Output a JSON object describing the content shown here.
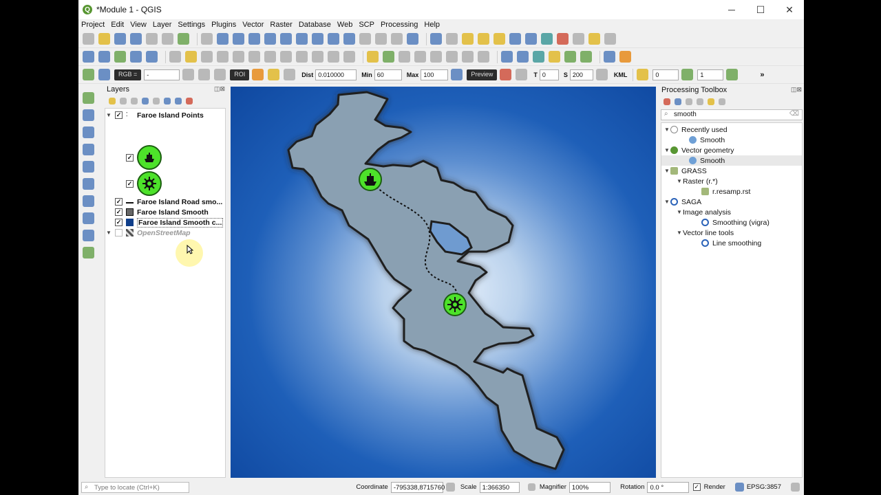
{
  "window": {
    "title": "*Module 1 - QGIS",
    "min": "─",
    "max": "☐",
    "close": "✕"
  },
  "menu": [
    "Project",
    "Edit",
    "View",
    "Layer",
    "Settings",
    "Plugins",
    "Vector",
    "Raster",
    "Database",
    "Web",
    "SCP",
    "Processing",
    "Help"
  ],
  "scp_toolbar": {
    "rgb_label": "RGB =",
    "rgb_value": "-",
    "roi_label": "ROI",
    "dist_label": "Dist",
    "dist_value": "0.010000",
    "min_label": "Min",
    "min_value": "60",
    "max_label": "Max",
    "max_value": "100",
    "preview_label": "Preview",
    "t_label": "T",
    "t_value": "0",
    "s_label": "S",
    "s_value": "200",
    "kml_label": "KML",
    "spin_a": "0",
    "spin_b": "1",
    "more": "»"
  },
  "layers_panel": {
    "title": "Layers",
    "items": [
      {
        "label": "Faroe Island Points",
        "checked": true,
        "expanded": true
      },
      {
        "label": "Faroe Island Road smo...",
        "checked": true
      },
      {
        "label": "Faroe Island Smooth",
        "checked": true
      },
      {
        "label": "Faroe Island Smooth c...",
        "checked": true
      },
      {
        "label": "OpenStreetMap",
        "checked": false
      }
    ]
  },
  "processing": {
    "title": "Processing Toolbox",
    "search_value": "smooth",
    "groups": [
      {
        "label": "Recently used",
        "children": [
          "Smooth"
        ]
      },
      {
        "label": "Vector geometry",
        "children": [
          "Smooth"
        ]
      },
      {
        "label": "GRASS",
        "sub": "Raster (r.*)",
        "children": [
          "r.resamp.rst"
        ]
      },
      {
        "label": "SAGA",
        "subs": [
          {
            "label": "Image analysis",
            "children": [
              "Smoothing (vigra)"
            ]
          },
          {
            "label": "Vector line tools",
            "children": [
              "Line smoothing"
            ]
          }
        ]
      }
    ]
  },
  "status": {
    "locate_placeholder": "Type to locate (Ctrl+K)",
    "coordinate_label": "Coordinate",
    "coordinate_value": "-795338,8715760",
    "scale_label": "Scale",
    "scale_value": "1:366350",
    "magnifier_label": "Magnifier",
    "magnifier_value": "100%",
    "rotation_label": "Rotation",
    "rotation_value": "0.0 °",
    "render_label": "Render",
    "crs": "EPSG:3857"
  },
  "colors": {
    "sea": "#1e5fb8",
    "land": "#8aa0b2",
    "marker": "#4de22a"
  }
}
